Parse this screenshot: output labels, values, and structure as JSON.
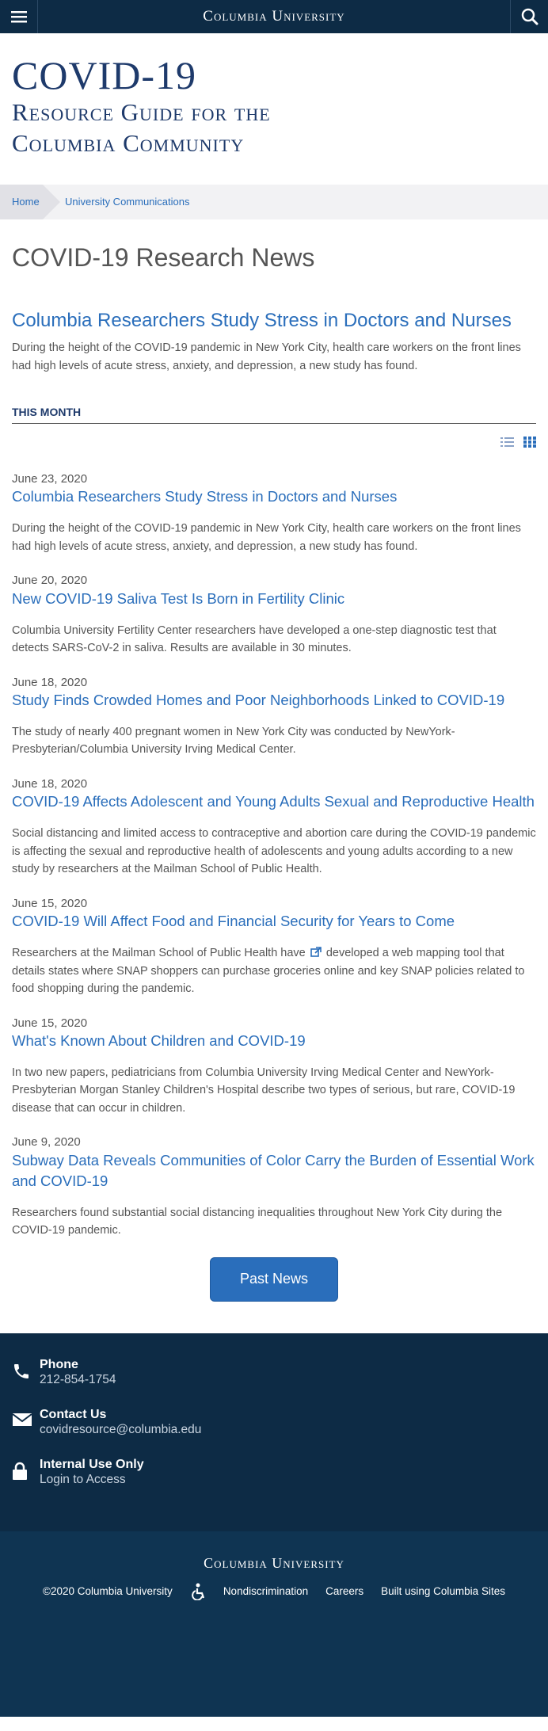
{
  "topbar": {
    "brand": "Columbia University",
    "menu_icon": "hamburger-icon",
    "search_icon": "search-icon"
  },
  "header": {
    "title_line1": "COVID-19",
    "title_line2": "Resource Guide for the",
    "title_line3": "Columbia Community"
  },
  "breadcrumb": {
    "home": "Home",
    "current": "University Communications"
  },
  "page_title": "COVID-19 Research News",
  "feature": {
    "title": "Columbia Researchers Study Stress in Doctors and Nurses",
    "desc": "During the height of the COVID-19 pandemic in New York City, health care workers on the front lines had high levels of acute stress, anxiety, and depression, a new study has found."
  },
  "section_label": "THIS MONTH",
  "view_toggle": {
    "list_icon": "list-view-icon",
    "grid_icon": "grid-view-icon"
  },
  "news": [
    {
      "date": "June 23, 2020",
      "title": "Columbia Researchers Study Stress in Doctors and Nurses",
      "desc": "During the height of the COVID-19 pandemic in New York City, health care workers on the front lines had high levels of acute stress, anxiety, and depression, a new study has found."
    },
    {
      "date": "June 20, 2020",
      "title": "New COVID-19 Saliva Test Is Born in Fertility Clinic",
      "desc": "Columbia University Fertility Center researchers have developed a one-step diagnostic test that detects SARS-CoV-2 in saliva. Results are available in 30 minutes."
    },
    {
      "date": "June 18, 2020",
      "title": "Study Finds Crowded Homes and Poor Neighborhoods Linked to COVID-19",
      "desc": "The study of nearly 400 pregnant women in New York City was conducted by NewYork-Presbyterian/Columbia University Irving Medical Center."
    },
    {
      "date": "June 18, 2020",
      "title": "COVID-19 Affects Adolescent and Young Adults Sexual and Reproductive Health",
      "desc": "Social distancing and limited access to contraceptive and abortion care during the COVID-19 pandemic is affecting the sexual and reproductive health of adolescents and young adults according to a new study by researchers at the Mailman School of Public Health."
    },
    {
      "date": "June 15, 2020",
      "title": "COVID-19 Will Affect Food and Financial Security for Years to Come",
      "desc_before": "Researchers at the Mailman School of Public Health have",
      "desc_link": "developed a web mapping tool",
      "desc_after": "that details states where SNAP shoppers can purchase groceries online and key SNAP policies related to food shopping during the pandemic."
    },
    {
      "date": "June 15, 2020",
      "title": "What's Known About Children and COVID-19",
      "desc": "In two new papers, pediatricians from Columbia University Irving Medical Center and NewYork-Presbyterian Morgan Stanley Children's Hospital describe two types of serious, but rare, COVID-19 disease that can occur in children."
    },
    {
      "date": "June 9, 2020",
      "title": "Subway Data Reveals Communities of Color Carry the Burden of Essential Work and COVID-19",
      "desc": "Researchers found substantial social distancing inequalities throughout New York City during the COVID-19 pandemic."
    }
  ],
  "past_news_label": "Past News",
  "footer": {
    "phone_label": "Phone",
    "phone_value": "212-854-1754",
    "contact_label": "Contact Us",
    "contact_value": "covidresource@columbia.edu",
    "internal_label": "Internal Use Only",
    "internal_link": "Login",
    "internal_after": "to Access",
    "brand": "Columbia University",
    "copyright": "©2020 Columbia University",
    "accessibility_icon": "accessibility-icon",
    "nondiscrimination": "Nondiscrimination",
    "careers": "Careers",
    "built_using": "Built using Columbia Sites"
  },
  "colors": {
    "navy": "#0d2b45",
    "link_blue": "#2a6ebb",
    "heading_navy": "#1e3a6b"
  }
}
